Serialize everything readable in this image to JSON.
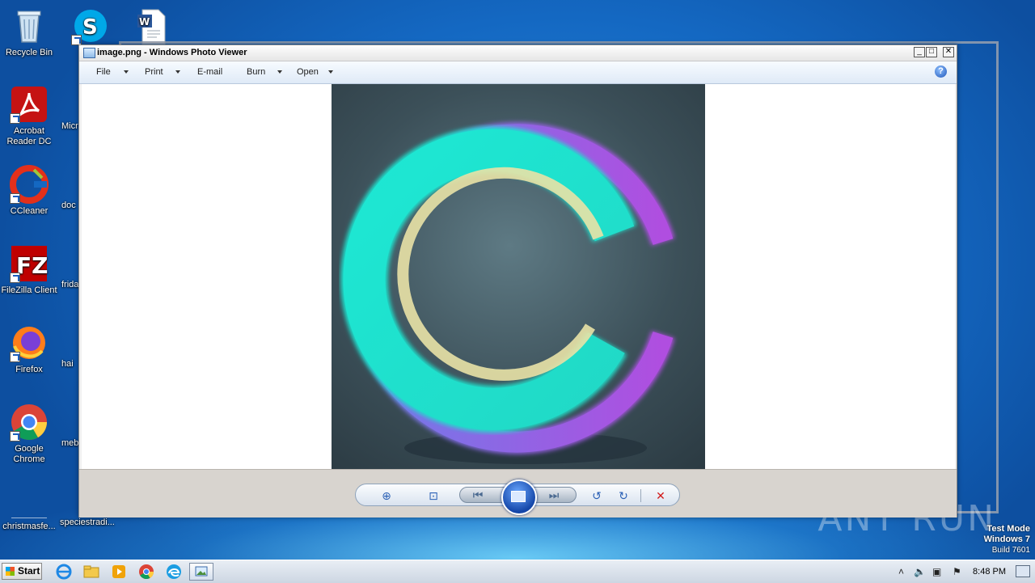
{
  "desktop": {
    "icons": [
      {
        "label": "Recycle Bin"
      },
      {
        "label": "Acrobat Reader DC"
      },
      {
        "label": "CCleaner"
      },
      {
        "label": "FileZilla Client"
      },
      {
        "label": "Firefox"
      },
      {
        "label": "Google Chrome"
      },
      {
        "label": "christmasfe..."
      },
      {
        "label": "Micr"
      },
      {
        "label": "doc"
      },
      {
        "label": "frida"
      },
      {
        "label": "hai"
      },
      {
        "label": "meb"
      },
      {
        "label": "speciestradi..."
      }
    ]
  },
  "window": {
    "title": "image.png - Windows Photo Viewer",
    "menu": {
      "file": "File",
      "print": "Print",
      "email": "E-mail",
      "burn": "Burn",
      "open": "Open"
    },
    "help": "?",
    "controls_close": "✕"
  },
  "watermark": {
    "text": "ANY RUN"
  },
  "test_mode": {
    "line1": "Test Mode",
    "line2": "Windows 7",
    "line3": "Build 7601"
  },
  "taskbar": {
    "start_label": "Start",
    "clock": "8:48 PM"
  },
  "colors": {
    "desktop_blue": "#1468c2",
    "photo_background": "#3c5059",
    "logo_cyan": "#1de8d4",
    "logo_purple": "#b04ee0"
  }
}
